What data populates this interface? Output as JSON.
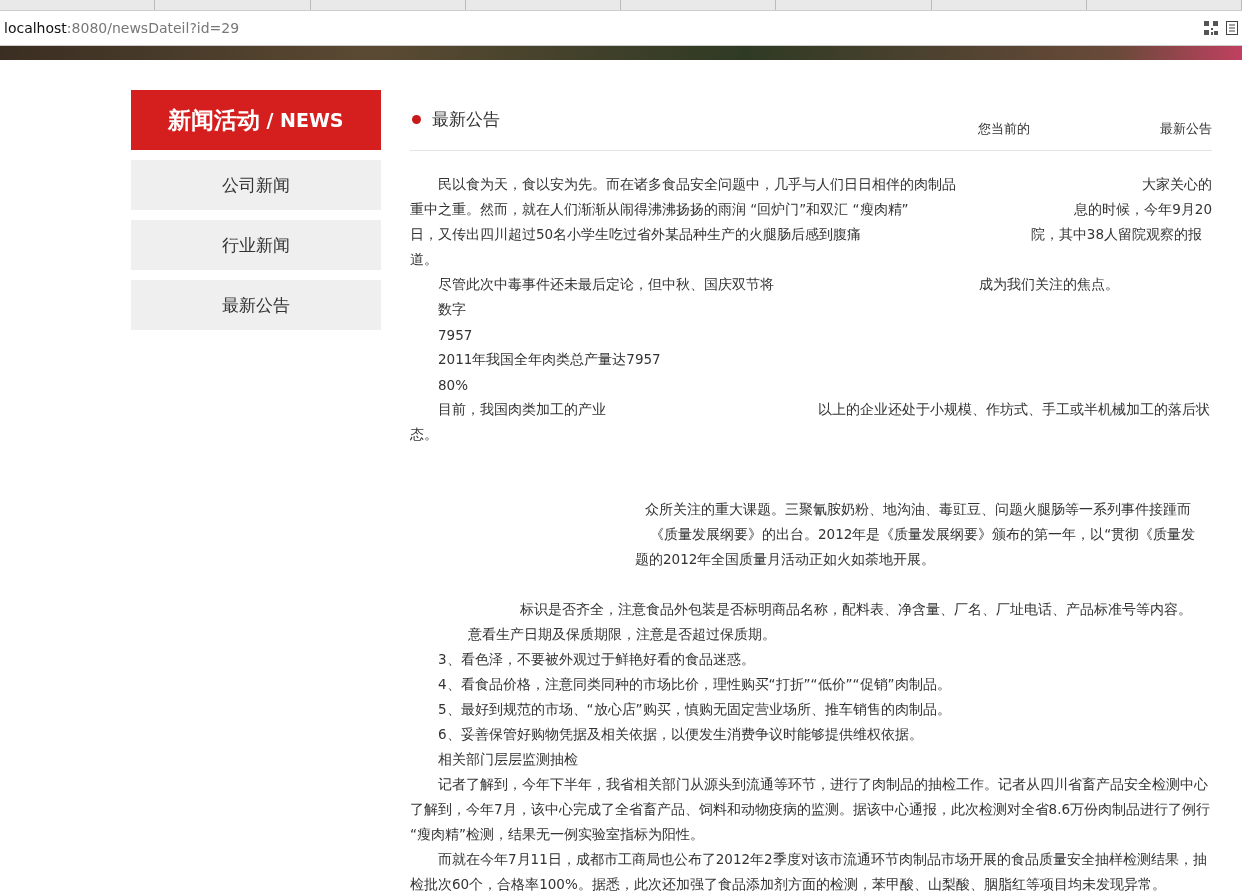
{
  "browser": {
    "address_host": "localhost",
    "address_path": ":8080/newsDateil?id=29"
  },
  "sidebar": {
    "title": "新闻活动",
    "subtitle": "/ NEWS",
    "items": [
      {
        "label": "公司新闻"
      },
      {
        "label": "行业新闻"
      },
      {
        "label": "最新公告"
      }
    ]
  },
  "article": {
    "title": "最新公告",
    "breadcrumb_label": "您当前的",
    "breadcrumb_current": "最新公告",
    "lines": [
      {
        "segments": [
          "民以食为天，食以安为先。而在诸多食品安全问题中，几乎与人们日日相伴的肉制品",
          "大家关心的"
        ]
      },
      {
        "segments": [
          "重中之重。然而，就在人们渐渐从闹得沸沸扬扬的雨润 “回炉门”和双汇 “瘦肉精”",
          "息的时候，今年9月20"
        ]
      },
      {
        "segments": [
          "日，又传出四川超过50名小学生吃过省外某品种生产的火腿肠后感到腹痛",
          "院，其中38人留院观察的报"
        ]
      },
      {
        "segments": [
          "道。"
        ]
      },
      {
        "segments": [
          "尽管此次中毒事件还未最后定论，但中秋、国庆双节将",
          "成为我们关注的焦点。"
        ]
      },
      {
        "segments": [
          "数字"
        ]
      },
      {
        "segments": [
          "7957"
        ]
      },
      {
        "segments": [
          "2011年我国全年肉类总产量达7957"
        ]
      },
      {
        "segments": [
          "80%"
        ]
      },
      {
        "segments": [
          "目前，我国肉类加工的产业",
          "以上的企业还处于小规模、作坊式、手工或半机械加工的落后状"
        ]
      },
      {
        "segments": [
          "态。"
        ]
      },
      {
        "segments": [
          "众所关注的重大课题。三聚氰胺奶粉、地沟油、毒豇豆、问题火腿肠等一系列事件接踵而"
        ]
      },
      {
        "segments": [
          "《质量发展纲要》的出台。2012年是《质量发展纲要》颁布的第一年，以“贯彻《质量发"
        ]
      },
      {
        "segments": [
          "题的2012年全国质量月活动正如火如荼地开展。"
        ]
      },
      {
        "segments": [
          "标识是否齐全，注意食品外包装是否标明商品名称，配料表、净含量、厂名、厂址电话、产品标准号等内容。"
        ]
      },
      {
        "segments": [
          "意看生产日期及保质期限，注意是否超过保质期。"
        ]
      },
      {
        "segments": [
          "3、看色泽，不要被外观过于鲜艳好看的食品迷惑。"
        ]
      },
      {
        "segments": [
          "4、看食品价格，注意同类同种的市场比价，理性购买“打折”“低价”“促销”肉制品。"
        ]
      },
      {
        "segments": [
          "5、最好到规范的市场、“放心店”购买，慎购无固定营业场所、推车销售的肉制品。"
        ]
      },
      {
        "segments": [
          "6、妥善保管好购物凭据及相关依据，以便发生消费争议时能够提供维权依据。"
        ]
      },
      {
        "segments": [
          "相关部门层层监测抽检"
        ]
      },
      {
        "segments": [
          "记者了解到，今年下半年，我省相关部门从源头到流通等环节，进行了肉制品的抽检工作。记者从四川省畜产品安全检测中心"
        ]
      },
      {
        "segments": [
          "了解到，今年7月，该中心完成了全省畜产品、饲料和动物疫病的监测。据该中心通报，此次检测对全省8.6万份肉制品进行了例行"
        ]
      },
      {
        "segments": [
          "“瘦肉精”检测，结果无一例实验室指标为阳性。"
        ]
      },
      {
        "segments": [
          "而就在今年7月11日，成都市工商局也公布了2012年2季度对该市流通环节肉制品市场开展的食品质量安全抽样检测结果，抽"
        ]
      },
      {
        "segments": [
          "检批次60个，合格率100%。据悉，此次还加强了食品添加剂方面的检测，苯甲酸、山梨酸、胭脂红等项目均未发现异常。"
        ]
      }
    ]
  }
}
